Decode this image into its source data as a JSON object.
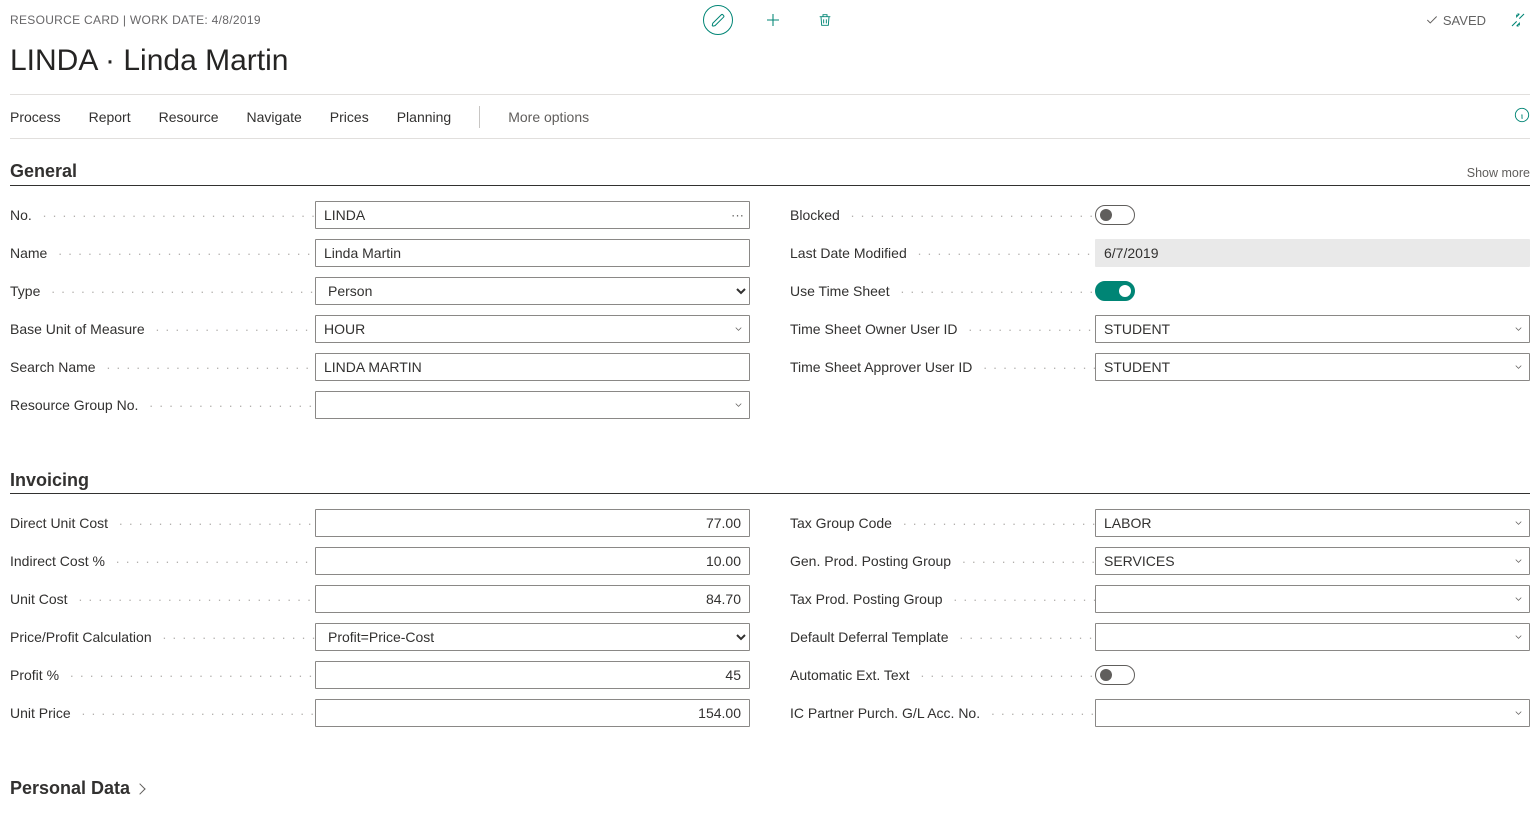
{
  "context": {
    "label": "RESOURCE CARD | WORK DATE: 4/8/2019"
  },
  "title": "LINDA · Linda Martin",
  "status": {
    "saved": "SAVED"
  },
  "actions": {
    "process": "Process",
    "report": "Report",
    "resource": "Resource",
    "navigate": "Navigate",
    "prices": "Prices",
    "planning": "Planning",
    "more": "More options"
  },
  "sections": {
    "general": {
      "title": "General",
      "showmore": "Show more"
    },
    "invoicing": {
      "title": "Invoicing"
    },
    "personal": {
      "title": "Personal Data"
    }
  },
  "general": {
    "no_label": "No.",
    "no": "LINDA",
    "name_label": "Name",
    "name": "Linda Martin",
    "type_label": "Type",
    "type": "Person",
    "buom_label": "Base Unit of Measure",
    "buom": "HOUR",
    "search_label": "Search Name",
    "search": "LINDA MARTIN",
    "rgroup_label": "Resource Group No.",
    "rgroup": "",
    "blocked_label": "Blocked",
    "blocked": false,
    "ldm_label": "Last Date Modified",
    "ldm": "6/7/2019",
    "uts_label": "Use Time Sheet",
    "uts": true,
    "owner_label": "Time Sheet Owner User ID",
    "owner": "STUDENT",
    "approver_label": "Time Sheet Approver User ID",
    "approver": "STUDENT"
  },
  "invoicing": {
    "duc_label": "Direct Unit Cost",
    "duc": "77.00",
    "ic_label": "Indirect Cost %",
    "ic": "10.00",
    "uc_label": "Unit Cost",
    "uc": "84.70",
    "ppc_label": "Price/Profit Calculation",
    "ppc": "Profit=Price-Cost",
    "profit_label": "Profit %",
    "profit": "45",
    "up_label": "Unit Price",
    "up": "154.00",
    "tgc_label": "Tax Group Code",
    "tgc": "LABOR",
    "gppg_label": "Gen. Prod. Posting Group",
    "gppg": "SERVICES",
    "tppg_label": "Tax Prod. Posting Group",
    "tppg": "",
    "ddt_label": "Default Deferral Template",
    "ddt": "",
    "aet_label": "Automatic Ext. Text",
    "aet": false,
    "ic_partner_label": "IC Partner Purch. G/L Acc. No.",
    "ic_partner": ""
  }
}
